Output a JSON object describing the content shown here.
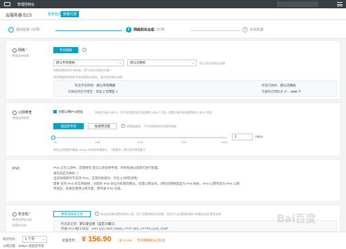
{
  "topbar": {
    "title": "管理控制台"
  },
  "product": {
    "name": "云服务器 ECS",
    "tab_monthly": "包年包月",
    "tab_payg": "按量付费"
  },
  "steps": [
    {
      "num": "✓",
      "label": "基础配置",
      "sub": "(必填)"
    },
    {
      "num": "2",
      "label": "网络和安全组",
      "sub": "(必填)"
    },
    {
      "num": "3",
      "label": "系统配置",
      "sub": ""
    }
  ],
  "network": {
    "label": "网络",
    "sub": "教我选择网络",
    "vpc_button": "专有网络",
    "classic_button": "经典网络",
    "vpc_select": "默认专有网络",
    "vswitch_select": "默认交换机",
    "zone_hint": "您可 前往控制台创建",
    "vpc_hint": "如需创建新的专有网络，您可 前往控制台创建 >",
    "hint2": "如您需要使用新的专有网络和交换机，请先到控制台创建",
    "left_kv": [
      {
        "k": "所选专有网络：",
        "v": "默认专有网络"
      },
      {
        "k": "交换机所在可用区：",
        "v": "华北 2 可用区 A"
      }
    ],
    "right_kv": [
      {
        "k": "所选交换机：",
        "v": "默认交换机"
      },
      {
        "k": "交换机可用私有 IP：",
        "v": "4090 个"
      }
    ]
  },
  "bandwidth": {
    "label": "公网带宽",
    "sub": "教我选择带宽",
    "assign_ip": "分配公网IPv4地址",
    "assign_desc": "系统会分配公网 IP，也可采用更加灵活的弹性公网 IP 方案，配置详情 如何配置弹性公网 IP 地址",
    "by_bandwidth": "按固定带宽",
    "by_traffic": "按使用流量",
    "bill_desc": "带宽值越高，下行带宽按照实际使用收取",
    "ticks": [
      "1M",
      "25M",
      "50M",
      "75M",
      "100M"
    ],
    "value": "1",
    "unit": "Mbps",
    "note": "阿里云免费提供最高 5Mbps 的突发带宽能力，了解更多 | 提升您的带宽能力"
  },
  "ipv6": {
    "label": "IPv6",
    "lines": [
      "IPv6 正在公测中，您需要先 提交公测资格申请，待审批通过后即可进行配置。",
      "请先指定交换机 ⓘ",
      "当前地域暂时不支持 IPv6，支持的地域为：华北 5 (呼和浩特)",
      "需要 支持 IPv6 的实例规格，分配的 IPv6 地址为私网到网址，如需公网访问，请购买网络类型为 IPv6 网关，IPv6 公网带宽为 IPv6 公网",
      "带宽后，如果您使用公网流量，需开通 IPv6 功能。"
    ]
  },
  "security": {
    "label": "安全组",
    "sub1": "教我选择安全组",
    "sub2": "配置安全组",
    "button": "重新选择安全组",
    "desc": "安全组用来设置实例防火墙，用于设置网络访问控制，您也可以在管理控制台 新建安全组 教我选择",
    "selected_label": "所选安全组：",
    "selected_value": "默认安全组（自定义端口）",
    "ports": "开通 IPv4 端口/协议：SSH (22), RDP (3389), HTTP (80), HTTPS (443), ICMP"
  },
  "footer": {
    "duration_label": "购买时长：",
    "duration_value": "1 个月",
    "fee_label": "配置费用：",
    "price": "¥ 156.90",
    "save": "省 ¥ 1.80",
    "fee_note": "专有网络部分已包含",
    "bandwidth_label": "公网流量：",
    "bandwidth_value": "5Mbps 按固定带宽"
  },
  "watermark": "Bai百度"
}
